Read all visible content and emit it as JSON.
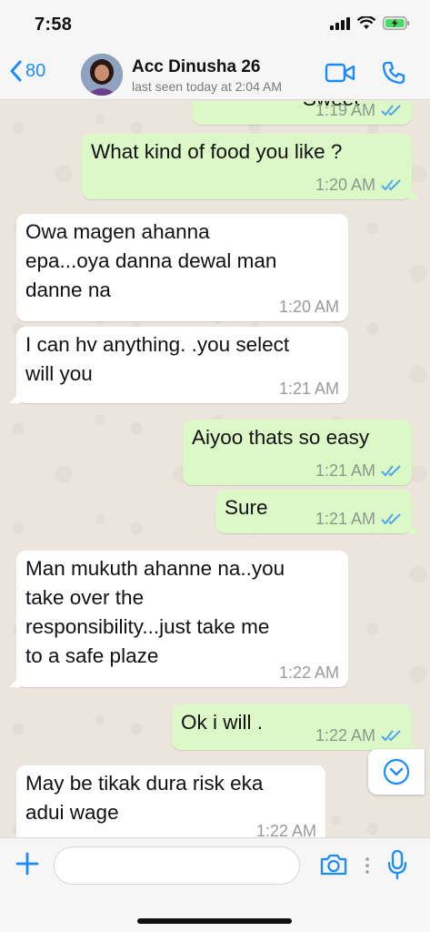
{
  "status_bar": {
    "time": "7:58"
  },
  "header": {
    "back_count": "80",
    "contact_name": "Acc Dinusha 26",
    "last_seen": "last seen today at 2:04 AM",
    "icons": [
      "chevron-left-icon",
      "video-call-icon",
      "phone-icon"
    ]
  },
  "messages": [
    {
      "direction": "out",
      "text": "Sweet",
      "time": "1:19 AM",
      "read": true,
      "partially_visible": true
    },
    {
      "direction": "out",
      "text": "What kind of food you like ?",
      "time": "1:20 AM",
      "read": true
    },
    {
      "direction": "in",
      "text": "Owa magen ahanna\nepa...oya danna dewal man\ndanne na",
      "time": "1:20 AM"
    },
    {
      "direction": "in",
      "text": "I can hv anything. .you select\nwill you",
      "time": "1:21 AM"
    },
    {
      "direction": "out",
      "text": "Aiyoo thats so easy",
      "time": "1:21 AM",
      "read": true
    },
    {
      "direction": "out",
      "text": "Sure",
      "time": "1:21 AM",
      "read": true
    },
    {
      "direction": "in",
      "text": "Man mukuth ahanne na..you\ntake over the\nresponsibility...just take me\nto a safe plaze",
      "time": "1:22 AM"
    },
    {
      "direction": "out",
      "text": "Ok i will .",
      "time": "1:22 AM",
      "read": true
    },
    {
      "direction": "in",
      "text": "May be tikak dura risk eka\nadui wage",
      "time": "1:22 AM"
    }
  ],
  "composer": {
    "input_value": "",
    "icons": [
      "plus-icon",
      "camera-icon",
      "microphone-icon"
    ]
  },
  "colors": {
    "accent": "#1a8cff",
    "outgoing_bubble": "#dcf8c6",
    "incoming_bubble": "#ffffff",
    "chat_background": "#ece5dd",
    "read_ticks": "#4fa8e8"
  }
}
